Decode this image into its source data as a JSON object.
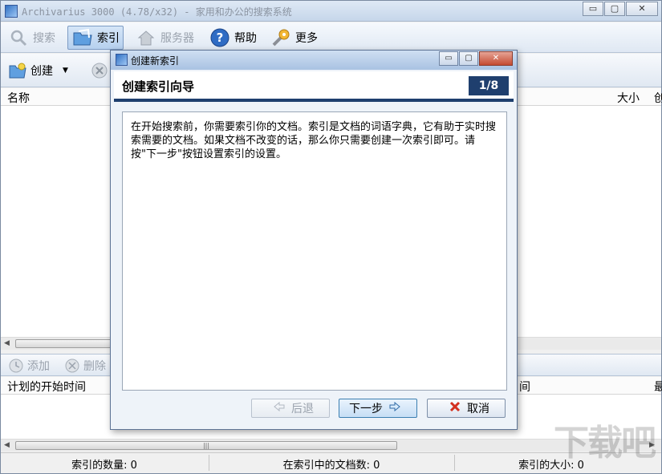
{
  "window": {
    "title": "Archivarius 3000 (4.78/x32) - 家用和办公的搜索系统",
    "controls": {
      "minimize": "▭",
      "restore": "▢",
      "close": "✕"
    }
  },
  "toolbar": {
    "items": [
      {
        "label": "搜索",
        "icon": "magnifier-icon",
        "state": "disabled"
      },
      {
        "label": "索引",
        "icon": "folder-index-icon",
        "state": "active"
      },
      {
        "label": "服务器",
        "icon": "house-icon",
        "state": "disabled"
      },
      {
        "label": "帮助",
        "icon": "help-icon",
        "state": "normal"
      },
      {
        "label": "更多",
        "icon": "wrench-icon",
        "state": "normal"
      }
    ]
  },
  "index_toolbar": {
    "create_label": "创建",
    "dropdown_arrow": "▼"
  },
  "index_list": {
    "columns": [
      "名称",
      "大小",
      "创"
    ]
  },
  "schedule_toolbar": {
    "add_label": "添加",
    "delete_label": "删除"
  },
  "schedule_list": {
    "columns": [
      "计划的开始时间",
      "间",
      "最"
    ],
    "scroll_grip": "|||"
  },
  "statusbar": {
    "index_count": "索引的数量: 0",
    "doc_count": "在索引中的文档数: 0",
    "index_size": "索引的大小: 0"
  },
  "dialog": {
    "title": "创建新索引",
    "heading": "创建索引向导",
    "step": "1/8",
    "body": "在开始搜索前，你需要索引你的文档。索引是文档的词语字典，它有助于实时搜索需要的文档。如果文档不改变的话，那么你只需要创建一次索引即可。请按\"下一步\"按钮设置索引的设置。",
    "buttons": {
      "back": "后退",
      "next": "下一步",
      "cancel": "取消"
    }
  },
  "watermark": "下载吧",
  "colors": {
    "accent": "#1f3f6e",
    "titlebar": "#c6d6ea"
  }
}
